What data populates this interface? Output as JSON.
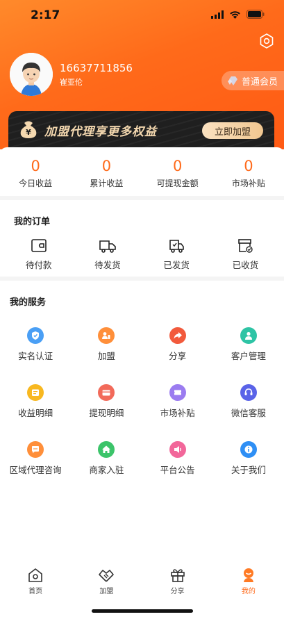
{
  "status_bar": {
    "time": "2:17"
  },
  "profile": {
    "phone": "16637711856",
    "name": "崔亚伦",
    "member_level": "普通会员"
  },
  "banner": {
    "text": "加盟代理享更多权益",
    "button": "立即加盟"
  },
  "stats": [
    {
      "value": "0",
      "label": "今日收益"
    },
    {
      "value": "0",
      "label": "累计收益"
    },
    {
      "value": "0",
      "label": "可提现金额"
    },
    {
      "value": "0",
      "label": "市场补贴"
    }
  ],
  "orders": {
    "title": "我的订单",
    "items": [
      {
        "label": "待付款",
        "icon": "wallet-icon"
      },
      {
        "label": "待发货",
        "icon": "truck-icon"
      },
      {
        "label": "已发货",
        "icon": "shipped-truck-icon"
      },
      {
        "label": "已收货",
        "icon": "received-box-icon"
      }
    ]
  },
  "services": {
    "title": "我的服务",
    "items": [
      {
        "label": "实名认证",
        "icon": "verify-icon",
        "color": "#4a9ff5"
      },
      {
        "label": "加盟",
        "icon": "join-icon",
        "color": "#ff8f3a"
      },
      {
        "label": "分享",
        "icon": "share-icon",
        "color": "#f25a3c"
      },
      {
        "label": "客户管理",
        "icon": "customer-icon",
        "color": "#2ec4a5"
      },
      {
        "label": "收益明细",
        "icon": "income-icon",
        "color": "#f8b820"
      },
      {
        "label": "提现明细",
        "icon": "withdraw-icon",
        "color": "#f26a5a"
      },
      {
        "label": "市场补贴",
        "icon": "subsidy-icon",
        "color": "#9b7cf0"
      },
      {
        "label": "微信客服",
        "icon": "headset-icon",
        "color": "#5a63e8"
      },
      {
        "label": "区域代理咨询",
        "icon": "chat-icon",
        "color": "#ff8f3a"
      },
      {
        "label": "商家入驻",
        "icon": "home-icon",
        "color": "#3cc46a"
      },
      {
        "label": "平台公告",
        "icon": "speaker-icon",
        "color": "#f2679a"
      },
      {
        "label": "关于我们",
        "icon": "info-icon",
        "color": "#2f8ff5"
      }
    ]
  },
  "tabbar": {
    "items": [
      {
        "label": "首页",
        "icon": "home-tab-icon"
      },
      {
        "label": "加盟",
        "icon": "handshake-icon"
      },
      {
        "label": "分享",
        "icon": "gift-icon"
      },
      {
        "label": "我的",
        "icon": "profile-tab-icon"
      }
    ]
  },
  "colors": {
    "accent": "#ff6a1a",
    "banner_bg": "#1f1f1f",
    "banner_text": "#f5d9b0"
  }
}
